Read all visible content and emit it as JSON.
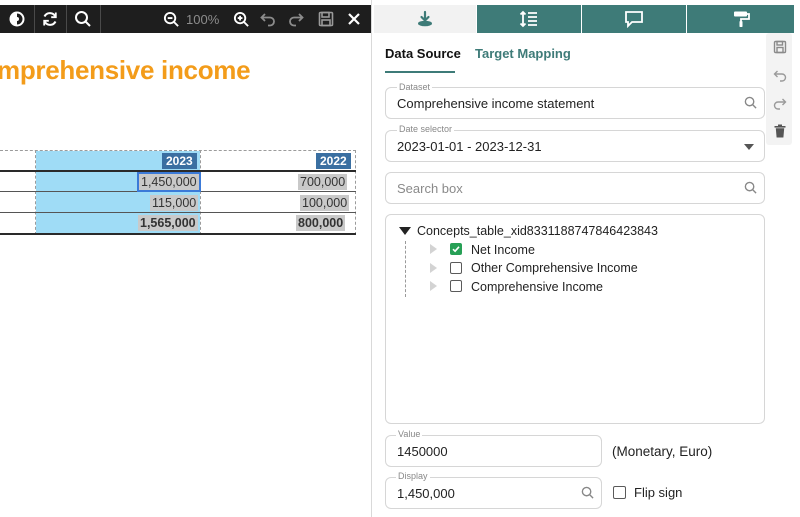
{
  "toolbar": {
    "zoom_label": "100%",
    "icons": [
      "eye-icon",
      "refresh-icon",
      "search-icon",
      "zoom-out-icon",
      "zoom-in-icon",
      "undo-icon",
      "redo-icon",
      "save-icon",
      "close-icon"
    ]
  },
  "document": {
    "title": "mprehensive income",
    "columns": [
      "2023",
      "2022"
    ],
    "rows": [
      [
        "1,450,000",
        "700,000"
      ],
      [
        "115,000",
        "100,000"
      ],
      [
        "1,565,000",
        "800,000"
      ]
    ]
  },
  "panel": {
    "tab_icons": [
      "mapping-icon",
      "sort-icon",
      "comment-icon",
      "format-paint-icon"
    ],
    "subtabs": [
      "Data Source",
      "Target Mapping"
    ],
    "active_subtab": "Data Source",
    "dataset": {
      "label": "Dataset",
      "value": "Comprehensive income statement"
    },
    "date_selector": {
      "label": "Date selector",
      "value": "2023-01-01 - 2023-12-31"
    },
    "search": {
      "placeholder": "Search box"
    },
    "tree": {
      "root": "Concepts_table_xid8331188747846423843",
      "children": [
        {
          "label": "Net Income",
          "checked": true
        },
        {
          "label": "Other Comprehensive Income",
          "checked": false
        },
        {
          "label": "Comprehensive Income",
          "checked": false
        }
      ]
    },
    "value": {
      "label": "Value",
      "value": "1450000",
      "unit": "(Monetary, Euro)"
    },
    "display": {
      "label": "Display",
      "value": "1,450,000"
    },
    "flip_sign": {
      "label": "Flip sign",
      "checked": false
    }
  },
  "colors": {
    "accent": "#3e7b78",
    "title_orange": "#f39c1a",
    "selection_blue": "#9fdcf6",
    "header_blue": "#3a6fa1",
    "check_green": "#27a056"
  }
}
